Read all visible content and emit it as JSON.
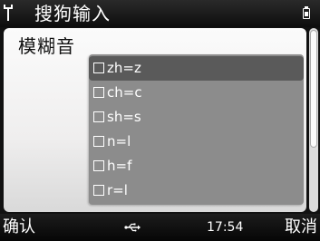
{
  "status_bar": {
    "title": "搜狗输入",
    "signal_icon": "antenna-icon",
    "battery_icon": "battery-icon"
  },
  "setting": {
    "title": "模糊音"
  },
  "options": [
    {
      "label": "zh=z",
      "checked": false,
      "highlighted": true
    },
    {
      "label": "ch=c",
      "checked": false,
      "highlighted": false
    },
    {
      "label": "sh=s",
      "checked": false,
      "highlighted": false
    },
    {
      "label": "n=l",
      "checked": false,
      "highlighted": false
    },
    {
      "label": "h=f",
      "checked": false,
      "highlighted": false
    },
    {
      "label": "r=l",
      "checked": false,
      "highlighted": false
    }
  ],
  "softkeys": {
    "left": "确认",
    "right": "取消",
    "center_icon": "usb-icon"
  },
  "clock": "17:54",
  "colors": {
    "list_background": "#8c8c8c",
    "highlight": "#5a5a5a",
    "panel": "#f4f4f4"
  }
}
